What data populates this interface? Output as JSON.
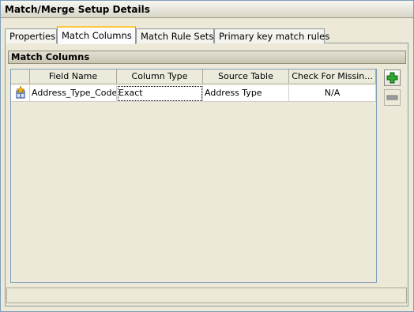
{
  "window": {
    "title": "Match/Merge Setup Details"
  },
  "tabs": [
    {
      "label": "Properties",
      "active": false
    },
    {
      "label": "Match Columns",
      "active": true
    },
    {
      "label": "Match Rule Sets",
      "active": false
    },
    {
      "label": "Primary key match rules",
      "active": false
    }
  ],
  "section": {
    "title": "Match Columns"
  },
  "table": {
    "columns": [
      "",
      "Field Name",
      "Column Type",
      "Source Table",
      "Check For Missin..."
    ],
    "rows": [
      {
        "icon": "key-column-icon",
        "field_name": "Address_Type_Code",
        "column_type": "Exact",
        "source_table": "Address Type",
        "check_missing": "N/A"
      }
    ]
  },
  "actions": {
    "add": {
      "icon": "add-plus-icon",
      "color": "#2fa82f"
    },
    "remove": {
      "icon": "remove-minus-icon",
      "color": "#9a9a9a"
    }
  }
}
